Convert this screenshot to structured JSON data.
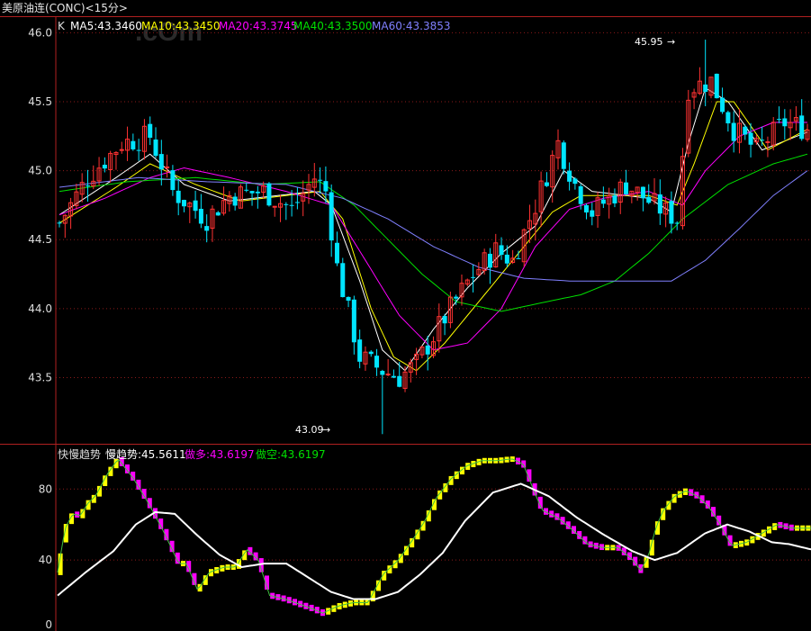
{
  "window": {
    "title": "美原油连(CONC)<15分>"
  },
  "colors": {
    "up": "#ff3232",
    "down": "#00e5ff",
    "ma5": "#ffffff",
    "ma10": "#ffff00",
    "ma20": "#ff00ff",
    "ma40": "#00e000",
    "ma60": "#8080ff",
    "fast": "#40c040",
    "slow": "#ffffff",
    "bull": "#ffff00",
    "bear": "#ff00ff",
    "grid": "#8b1a1a",
    "frame": "#b02020",
    "axis_text": "#dddddd"
  },
  "chart_data": [
    {
      "type": "candlestick",
      "legend": {
        "k": "K",
        "ma5": "MA5:43.3460",
        "ma10": "MA10:43.3450",
        "ma20": "MA20:43.3745",
        "ma40": "MA40:43.3500",
        "ma60": "MA60:43.3853"
      },
      "y_ticks": [
        "46.0",
        "45.5",
        "45.0",
        "44.5",
        "44.0",
        "43.5"
      ],
      "ylim": [
        43.02,
        46.12
      ],
      "annotations": {
        "high": "45.95",
        "low": "43.09"
      },
      "anchors": [
        [
          0,
          44.62
        ],
        [
          5,
          44.95
        ],
        [
          11,
          45.2
        ],
        [
          16,
          45.25
        ],
        [
          20,
          44.85
        ],
        [
          26,
          44.65
        ],
        [
          30,
          44.82
        ],
        [
          36,
          44.85
        ],
        [
          41,
          44.72
        ],
        [
          45,
          44.95
        ],
        [
          47,
          44.85
        ],
        [
          49,
          44.3
        ],
        [
          53,
          43.65
        ],
        [
          57,
          43.55
        ],
        [
          60,
          43.5
        ],
        [
          63,
          43.6
        ],
        [
          66,
          43.8
        ],
        [
          69,
          44.0
        ],
        [
          73,
          44.25
        ],
        [
          77,
          44.42
        ],
        [
          80,
          44.35
        ],
        [
          84,
          44.75
        ],
        [
          88,
          45.2
        ],
        [
          91,
          44.9
        ],
        [
          94,
          44.7
        ],
        [
          100,
          44.9
        ],
        [
          105,
          44.75
        ],
        [
          109,
          44.65
        ],
        [
          111,
          45.6
        ],
        [
          115,
          45.65
        ],
        [
          119,
          45.3
        ],
        [
          123,
          45.15
        ],
        [
          128,
          45.35
        ],
        [
          132,
          45.3
        ]
      ],
      "ma_series": {
        "ma5": [
          [
            0,
            44.68
          ],
          [
            10,
            44.95
          ],
          [
            16,
            45.12
          ],
          [
            22,
            44.9
          ],
          [
            30,
            44.78
          ],
          [
            45,
            44.85
          ],
          [
            48,
            44.75
          ],
          [
            53,
            44.2
          ],
          [
            57,
            43.7
          ],
          [
            61,
            43.55
          ],
          [
            66,
            43.85
          ],
          [
            72,
            44.15
          ],
          [
            78,
            44.4
          ],
          [
            84,
            44.6
          ],
          [
            89,
            45.0
          ],
          [
            94,
            44.85
          ],
          [
            104,
            44.8
          ],
          [
            108,
            44.7
          ],
          [
            111,
            45.2
          ],
          [
            114,
            45.6
          ],
          [
            118,
            45.5
          ],
          [
            124,
            45.15
          ],
          [
            132,
            45.28
          ]
        ],
        "ma10": [
          [
            0,
            44.62
          ],
          [
            10,
            44.88
          ],
          [
            16,
            45.05
          ],
          [
            24,
            44.9
          ],
          [
            32,
            44.78
          ],
          [
            46,
            44.85
          ],
          [
            50,
            44.65
          ],
          [
            55,
            44.0
          ],
          [
            59,
            43.65
          ],
          [
            63,
            43.55
          ],
          [
            68,
            43.75
          ],
          [
            74,
            44.05
          ],
          [
            80,
            44.35
          ],
          [
            87,
            44.7
          ],
          [
            92,
            44.82
          ],
          [
            104,
            44.82
          ],
          [
            109,
            44.75
          ],
          [
            112,
            45.05
          ],
          [
            116,
            45.5
          ],
          [
            119,
            45.5
          ],
          [
            125,
            45.15
          ],
          [
            132,
            45.3
          ]
        ],
        "ma20": [
          [
            0,
            44.68
          ],
          [
            8,
            44.8
          ],
          [
            16,
            44.95
          ],
          [
            22,
            45.02
          ],
          [
            30,
            44.95
          ],
          [
            40,
            44.85
          ],
          [
            48,
            44.75
          ],
          [
            54,
            44.35
          ],
          [
            60,
            43.95
          ],
          [
            66,
            43.7
          ],
          [
            72,
            43.75
          ],
          [
            78,
            44.0
          ],
          [
            84,
            44.45
          ],
          [
            90,
            44.72
          ],
          [
            96,
            44.8
          ],
          [
            104,
            44.85
          ],
          [
            110,
            44.75
          ],
          [
            114,
            45.0
          ],
          [
            120,
            45.25
          ],
          [
            126,
            45.35
          ],
          [
            132,
            45.35
          ]
        ],
        "ma40": [
          [
            0,
            44.85
          ],
          [
            12,
            44.92
          ],
          [
            24,
            44.95
          ],
          [
            36,
            44.9
          ],
          [
            46,
            44.92
          ],
          [
            52,
            44.75
          ],
          [
            58,
            44.5
          ],
          [
            64,
            44.25
          ],
          [
            70,
            44.05
          ],
          [
            78,
            43.98
          ],
          [
            86,
            44.05
          ],
          [
            92,
            44.1
          ],
          [
            98,
            44.2
          ],
          [
            104,
            44.4
          ],
          [
            110,
            44.65
          ],
          [
            118,
            44.9
          ],
          [
            126,
            45.05
          ],
          [
            132,
            45.12
          ]
        ],
        "ma60": [
          [
            0,
            44.88
          ],
          [
            14,
            44.95
          ],
          [
            26,
            44.92
          ],
          [
            40,
            44.9
          ],
          [
            50,
            44.8
          ],
          [
            58,
            44.65
          ],
          [
            66,
            44.45
          ],
          [
            74,
            44.3
          ],
          [
            82,
            44.22
          ],
          [
            90,
            44.2
          ],
          [
            100,
            44.2
          ],
          [
            108,
            44.2
          ],
          [
            114,
            44.35
          ],
          [
            120,
            44.58
          ],
          [
            126,
            44.82
          ],
          [
            132,
            45.0
          ]
        ]
      }
    },
    {
      "type": "line",
      "legend": {
        "name": "快慢趋势",
        "slow": "慢趋势:45.5611",
        "bull": "做多:43.6197",
        "bear": "做空:43.6197"
      },
      "y_ticks": [
        "80",
        "40",
        "0"
      ],
      "ylim": [
        0,
        105
      ],
      "fast": [
        [
          0,
          33
        ],
        [
          2,
          58
        ],
        [
          4,
          66
        ],
        [
          6,
          65
        ],
        [
          8,
          72
        ],
        [
          10,
          76
        ],
        [
          13,
          88
        ],
        [
          16,
          97
        ],
        [
          20,
          86
        ],
        [
          24,
          72
        ],
        [
          28,
          56
        ],
        [
          32,
          38
        ],
        [
          34,
          38
        ],
        [
          37,
          23
        ],
        [
          40,
          33
        ],
        [
          44,
          36
        ],
        [
          47,
          36
        ],
        [
          50,
          46
        ],
        [
          53,
          40
        ],
        [
          56,
          20
        ],
        [
          60,
          18
        ],
        [
          64,
          15
        ],
        [
          68,
          12
        ],
        [
          70,
          10
        ],
        [
          74,
          14
        ],
        [
          78,
          16
        ],
        [
          82,
          16
        ],
        [
          86,
          32
        ],
        [
          90,
          40
        ],
        [
          94,
          52
        ],
        [
          97,
          62
        ],
        [
          100,
          75
        ],
        [
          104,
          86
        ],
        [
          108,
          93
        ],
        [
          112,
          96
        ],
        [
          116,
          96
        ],
        [
          120,
          97
        ],
        [
          123,
          94
        ],
        [
          126,
          78
        ],
        [
          128,
          68
        ],
        [
          132,
          64
        ],
        [
          136,
          57
        ],
        [
          140,
          49
        ],
        [
          144,
          47
        ],
        [
          148,
          47
        ],
        [
          152,
          40
        ],
        [
          154,
          34
        ],
        [
          156,
          42
        ],
        [
          158,
          58
        ],
        [
          160,
          68
        ],
        [
          163,
          76
        ],
        [
          166,
          79
        ],
        [
          169,
          76
        ],
        [
          172,
          70
        ],
        [
          175,
          60
        ],
        [
          178,
          48
        ],
        [
          182,
          50
        ],
        [
          186,
          55
        ],
        [
          190,
          60
        ],
        [
          194,
          58
        ],
        [
          198,
          58
        ]
      ],
      "slow": [
        [
          0,
          20
        ],
        [
          10,
          33
        ],
        [
          20,
          45
        ],
        [
          28,
          60
        ],
        [
          35,
          67
        ],
        [
          42,
          66
        ],
        [
          50,
          54
        ],
        [
          58,
          43
        ],
        [
          66,
          36
        ],
        [
          74,
          38
        ],
        [
          82,
          38
        ],
        [
          90,
          30
        ],
        [
          98,
          22
        ],
        [
          106,
          18
        ],
        [
          114,
          18
        ],
        [
          122,
          22
        ],
        [
          130,
          32
        ],
        [
          138,
          44
        ],
        [
          146,
          62
        ],
        [
          156,
          78
        ],
        [
          166,
          83
        ],
        [
          176,
          76
        ],
        [
          186,
          64
        ],
        [
          196,
          54
        ],
        [
          206,
          45
        ],
        [
          214,
          40
        ],
        [
          222,
          44
        ],
        [
          232,
          55
        ],
        [
          240,
          60
        ],
        [
          248,
          56
        ],
        [
          256,
          50
        ],
        [
          262,
          49
        ],
        [
          270,
          46
        ]
      ],
      "bull_bar_mode": true
    }
  ]
}
